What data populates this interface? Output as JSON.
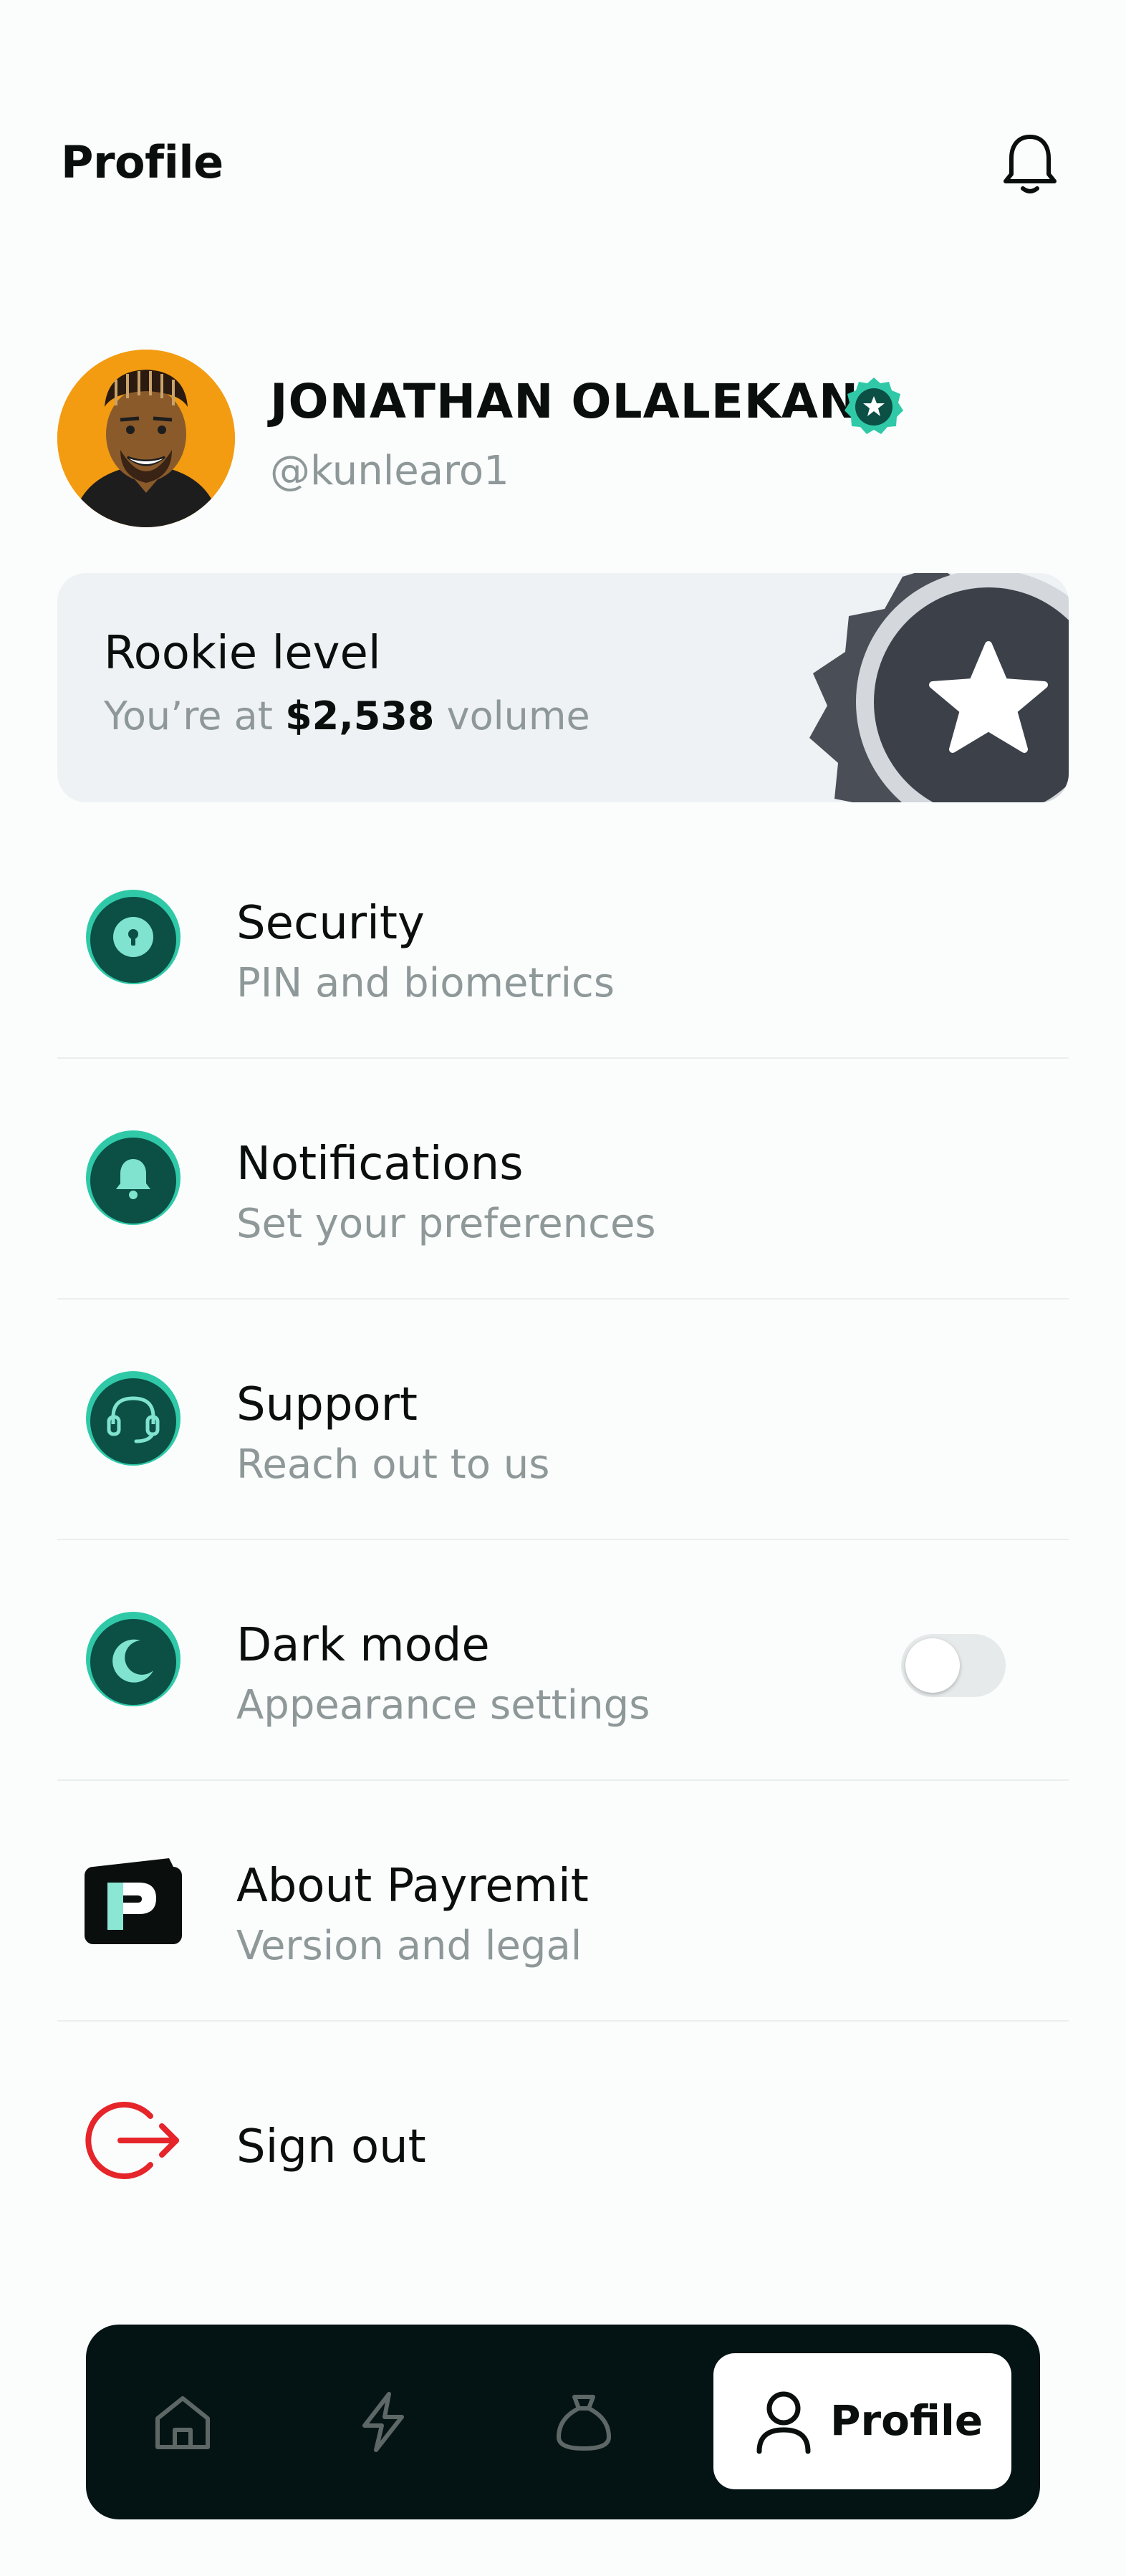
{
  "header": {
    "title": "Profile",
    "notification_icon": "bell-icon"
  },
  "user": {
    "name": "JONATHAN OLALEKAN",
    "handle": "@kunlearo1",
    "verified_icon": "verified-badge-icon"
  },
  "level_card": {
    "title": "Rookie level",
    "sub_prefix": "You’re at ",
    "amount": "$2,538",
    "sub_suffix": " volume",
    "badge_icon": "star-medal-icon"
  },
  "menu": [
    {
      "label": "Security",
      "sub": "PIN and biometrics",
      "icon": "lock-icon"
    },
    {
      "label": "Notifications",
      "sub": "Set your preferences",
      "icon": "bell-icon"
    },
    {
      "label": "Support",
      "sub": "Reach out to us",
      "icon": "headset-icon"
    },
    {
      "label": "Dark mode",
      "sub": "Appearance settings",
      "icon": "moon-icon",
      "toggle_on": false
    },
    {
      "label": "About Payremit",
      "sub": "Version and legal",
      "icon": "payremit-logo-icon"
    },
    {
      "label": "Sign out",
      "icon": "sign-out-icon"
    }
  ],
  "bottom_nav": {
    "items": [
      {
        "icon": "home-icon"
      },
      {
        "icon": "lightning-icon"
      },
      {
        "icon": "money-bag-icon"
      },
      {
        "icon": "user-icon",
        "label": "Profile",
        "active": true
      }
    ]
  },
  "colors": {
    "accent": "#16a58a",
    "accent_dark": "#0b4f45",
    "nav_bg": "#041313",
    "danger": "#e5252a",
    "card_bg": "#eef2f5",
    "muted_text": "#8f9898"
  }
}
